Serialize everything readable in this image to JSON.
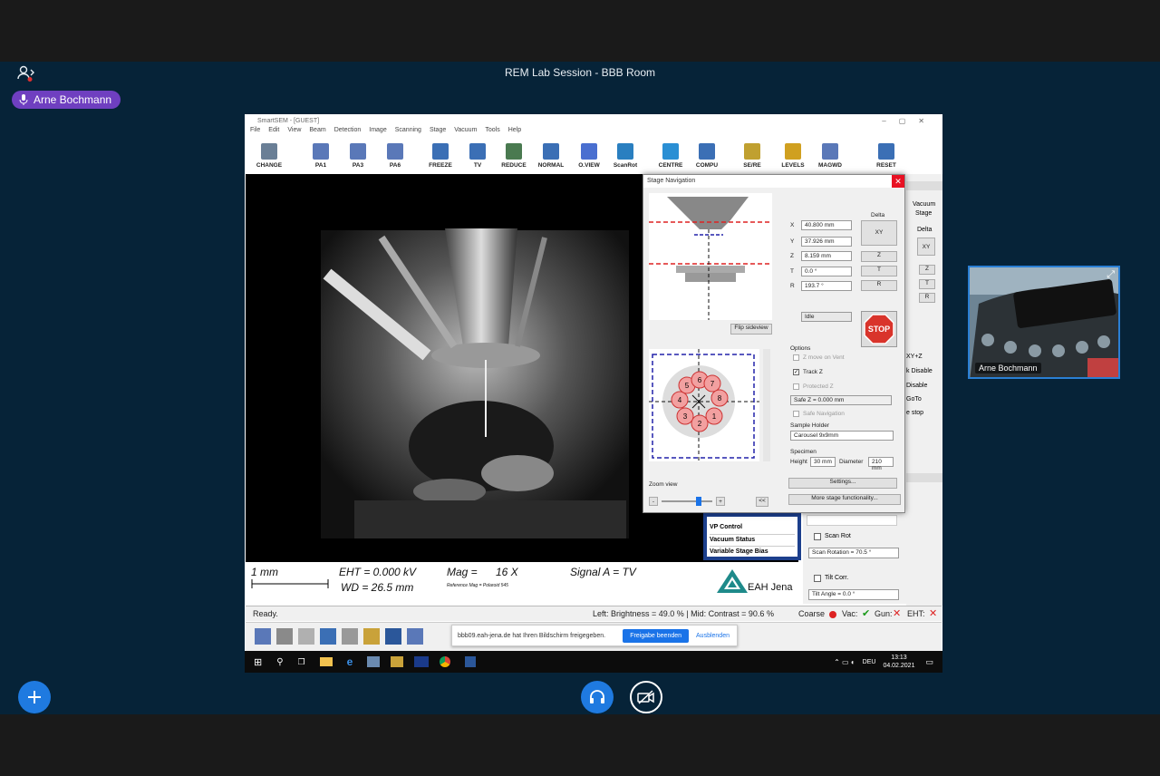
{
  "room": {
    "title": "REM Lab Session - BBB Room",
    "presenter": "Arne Bochmann"
  },
  "sem": {
    "window_title": "SmartSEM - [GUEST]",
    "menu": [
      "File",
      "Edit",
      "View",
      "Beam",
      "Detection",
      "Image",
      "Scanning",
      "Stage",
      "Vacuum",
      "Tools",
      "Help"
    ],
    "toolbar": [
      "CHANGE",
      "PA1",
      "PA3",
      "PA6",
      "FREEZE",
      "TV",
      "REDUCE",
      "NORMAL",
      "O.VIEW",
      "ScanRot",
      "CENTRE",
      "COMPU",
      "SE/RE",
      "LEVELS",
      "MAGWD",
      "RESET"
    ],
    "info": {
      "scale": "1 mm",
      "eht": "EHT = 0.000 kV",
      "wd": "WD = 26.5 mm",
      "mag_label": "Mag =",
      "mag_value": "16 X",
      "signal": "Signal A = TV",
      "ref": "Reference Mag = Polaroid 545",
      "logo": "EAH Jena"
    },
    "status": {
      "ready": "Ready.",
      "brightness": "Left: Brightness = 49.0 % | Mid: Contrast = 90.6 %",
      "coarse": "Coarse",
      "vac": "Vac:",
      "gun": "Gun:",
      "eht": "EHT:"
    },
    "right_panel": {
      "vacuum": "Vacuum",
      "stage": "Stage",
      "delta": "Delta",
      "xy": "XY",
      "z": "Z",
      "t": "T",
      "r": "R",
      "xyz": "XY+Z",
      "k_disable": "k Disable",
      "disable": "Disable",
      "goto": "GoTo",
      "stop": "e stop",
      "scan_rot": "Scan Rot",
      "scan_rotation": "Scan Rotation =  70.5 °",
      "tilt_corr": "Tilt Corr.",
      "tilt_angle": "Tilt Angle =   0.0 °"
    },
    "list_items": [
      "VP Control",
      "Vacuum Status",
      "Variable Stage Bias"
    ]
  },
  "stage_nav": {
    "title": "Stage Navigation",
    "x": "40.800 mm",
    "y": "37.926 mm",
    "z": "8.159 mm",
    "t": "0.0 °",
    "r": "193.7 °",
    "delta": "Delta",
    "btn_xy": "XY",
    "btn_z": "Z",
    "btn_t": "T",
    "btn_r": "R",
    "idle": "Idle",
    "flip": "Flip sideview",
    "stop": "STOP",
    "options": "Options",
    "z_move": "Z move on Vent",
    "track_z": "Track Z",
    "protected_z": "Protected Z",
    "safe_z": "Safe Z =  0.000 mm",
    "safe_nav": "Safe Navigation",
    "sample_holder": "Sample Holder",
    "holder_value": "Carousel 9x9mm",
    "specimen": "Specimen",
    "height_lbl": "Height",
    "height_val": "30 mm",
    "diameter_lbl": "Diameter",
    "diameter_val": "210 mm",
    "zoom": "Zoom view",
    "settings": "Settings...",
    "more": "More stage functionality...",
    "carousel": [
      "1",
      "2",
      "3",
      "4",
      "5",
      "6",
      "7",
      "8"
    ],
    "collapse": "<<"
  },
  "share": {
    "notice": "bbb09.eah-jena.de hat Ihren Bildschirm freigegeben.",
    "stop_btn": "Freigabe beenden",
    "hide_btn": "Ausblenden"
  },
  "taskbar": {
    "lang": "DEU",
    "time": "13:13",
    "date": "04.02.2021"
  },
  "colors": {
    "stage_bg": "#062338",
    "pill": "#6f3fc0",
    "accent": "#2a7fd4",
    "stop_red": "#d9342b"
  }
}
